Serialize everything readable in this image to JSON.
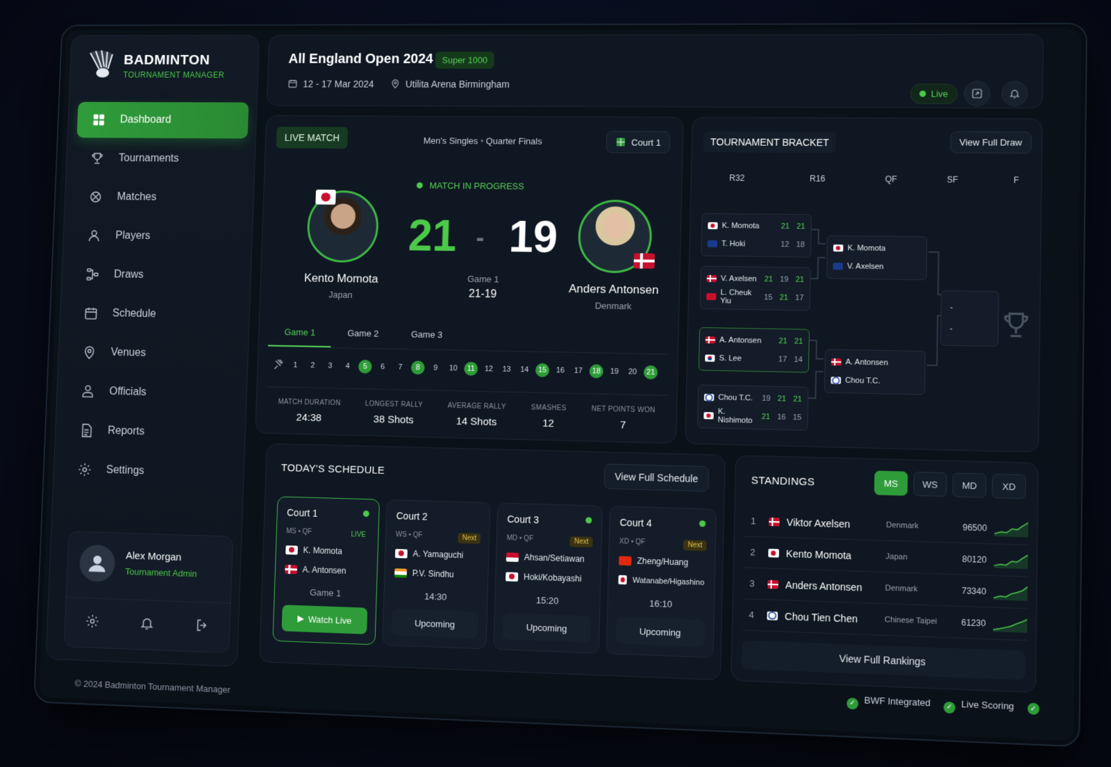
{
  "app": {
    "title": "BADMINTON",
    "subtitle": "TOURNAMENT MANAGER",
    "footer": "© 2024 Badminton Tournament Manager"
  },
  "nav": [
    {
      "label": "Dashboard",
      "icon": "grid-icon",
      "active": true
    },
    {
      "label": "Tournaments",
      "icon": "trophy-icon"
    },
    {
      "label": "Matches",
      "icon": "shuttlecock-icon"
    },
    {
      "label": "Players",
      "icon": "user-icon"
    },
    {
      "label": "Draws",
      "icon": "bracket-icon"
    },
    {
      "label": "Schedule",
      "icon": "calendar-icon"
    },
    {
      "label": "Venues",
      "icon": "location-icon"
    },
    {
      "label": "Officials",
      "icon": "official-icon"
    },
    {
      "label": "Reports",
      "icon": "document-icon"
    },
    {
      "label": "Settings",
      "icon": "gear-icon"
    }
  ],
  "user": {
    "name": "Alex Morgan",
    "role": "Tournament Admin"
  },
  "header": {
    "title": "All England Open 2024",
    "badge": "Super 1000",
    "dates": "12 - 17 Mar 2024",
    "venue": "Utilita Arena Birmingham",
    "live": "Live"
  },
  "live_match": {
    "tag": "LIVE MATCH",
    "category": "Men's Singles",
    "round": "Quarter Finals",
    "court": "Court 1",
    "status": "MATCH IN PROGRESS",
    "p1": {
      "name": "Kento Momota",
      "country": "Japan",
      "score": "21"
    },
    "p2": {
      "name": "Anders Antonsen",
      "country": "Denmark",
      "score": "19"
    },
    "separator": "-",
    "game_label": "Game 1",
    "game_score": "21-19",
    "tabs": [
      "Game 1",
      "Game 2",
      "Game 3"
    ],
    "points": [
      "1",
      "2",
      "3",
      "4",
      "5",
      "6",
      "7",
      "8",
      "9",
      "10",
      "11",
      "12",
      "13",
      "14",
      "15",
      "16",
      "17",
      "18",
      "19",
      "20",
      "21"
    ],
    "won_points": [
      "5",
      "8",
      "11",
      "15",
      "18",
      "21"
    ],
    "stats": [
      {
        "label": "MATCH DURATION",
        "value": "24:38"
      },
      {
        "label": "LONGEST RALLY",
        "value": "38 Shots"
      },
      {
        "label": "AVERAGE RALLY",
        "value": "14 Shots"
      },
      {
        "label": "SMASHES",
        "value": "12"
      },
      {
        "label": "NET POINTS WON",
        "value": "7"
      }
    ]
  },
  "bracket": {
    "title": "TOURNAMENT BRACKET",
    "button": "View Full Draw",
    "rounds": [
      "R32",
      "R16",
      "QF",
      "SF",
      "F"
    ],
    "r16": [
      {
        "a": "K. Momota",
        "as": [
          "21",
          "21"
        ],
        "b": "T. Hoki",
        "bs": [
          "12",
          "18"
        ]
      },
      {
        "a": "V. Axelsen",
        "as": [
          "21",
          "19",
          "21"
        ],
        "b": "L. Cheuk Yiu",
        "bs": [
          "15",
          "21",
          "17"
        ]
      },
      {
        "a": "A. Antonsen",
        "as": [
          "21",
          "21"
        ],
        "b": "S. Lee",
        "bs": [
          "17",
          "14"
        ]
      },
      {
        "a": "Chou T.C.",
        "as": [
          "19",
          "21",
          "21"
        ],
        "b": "K. Nishimoto",
        "bs": [
          "21",
          "16",
          "15"
        ]
      }
    ],
    "qf": [
      {
        "a": "K. Momota",
        "b": "V. Axelsen"
      },
      {
        "a": "A. Antonsen",
        "b": "Chou T.C."
      }
    ],
    "sf": {
      "a": "-",
      "b": "-"
    }
  },
  "schedule": {
    "title": "TODAY'S SCHEDULE",
    "button": "View Full Schedule",
    "courts": [
      {
        "name": "Court 1",
        "type": "MS • QF",
        "status": "LIVE",
        "p1": "K. Momota",
        "p2": "A. Antonsen",
        "info": "Game 1",
        "action": "Watch Live"
      },
      {
        "name": "Court 2",
        "type": "WS • QF",
        "status": "Next",
        "p1": "A. Yamaguchi",
        "p2": "P.V. Sindhu",
        "info": "14:30",
        "action": "Upcoming"
      },
      {
        "name": "Court 3",
        "type": "MD • QF",
        "status": "Next",
        "p1": "Ahsan/Setiawan",
        "p2": "Hoki/Kobayashi",
        "info": "15:20",
        "action": "Upcoming"
      },
      {
        "name": "Court 4",
        "type": "XD • QF",
        "status": "Next",
        "p1": "Zheng/Huang",
        "p2": "Watanabe/Higashino",
        "info": "16:10",
        "action": "Upcoming"
      }
    ]
  },
  "standings": {
    "title": "STANDINGS",
    "tabs": [
      "MS",
      "WS",
      "MD",
      "XD"
    ],
    "active_tab": "MS",
    "rows": [
      {
        "rank": "1",
        "name": "Viktor Axelsen",
        "country": "Denmark",
        "points": "96500"
      },
      {
        "rank": "2",
        "name": "Kento Momota",
        "country": "Japan",
        "points": "80120"
      },
      {
        "rank": "3",
        "name": "Anders Antonsen",
        "country": "Denmark",
        "points": "73340"
      },
      {
        "rank": "4",
        "name": "Chou Tien Chen",
        "country": "Chinese Taipei",
        "points": "61230"
      }
    ],
    "button": "View Full Rankings"
  },
  "badges": [
    "BWF Integrated",
    "Live Scoring"
  ],
  "colors": {
    "accent": "#2f9c3a",
    "accent_text": "#56d256",
    "background": "#0b1119",
    "card": "#0f1722"
  }
}
